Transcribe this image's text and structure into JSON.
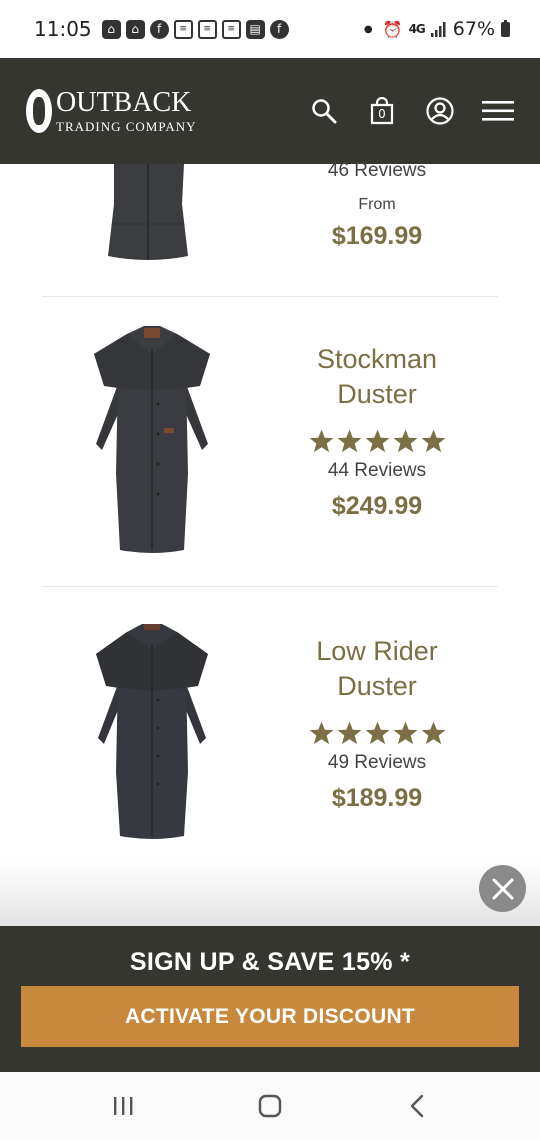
{
  "status_bar": {
    "time": "11:05",
    "network": "4G",
    "battery": "67%",
    "notification_icons": [
      "nextdoor-icon",
      "nextdoor-icon",
      "facebook-icon",
      "news-icon",
      "news-icon",
      "news-icon",
      "newspaper-app-icon",
      "facebook-icon"
    ],
    "system_icons": [
      "alarm-icon",
      "lte-icon",
      "signal-icon",
      "battery-icon"
    ]
  },
  "header": {
    "logo_main": "OUTBACK",
    "logo_sub": "TRADING COMPANY",
    "cart_count": "0",
    "icons": [
      "search-icon",
      "cart-icon",
      "account-icon",
      "menu-icon"
    ]
  },
  "products": [
    {
      "reviews": "46 Reviews",
      "price_prefix": "From",
      "price": "$169.99"
    },
    {
      "title_line1": "Stockman",
      "title_line2": "Duster",
      "stars": 5,
      "reviews": "44 Reviews",
      "price": "$249.99"
    },
    {
      "title_line1": "Low Rider",
      "title_line2": "Duster",
      "stars": 5,
      "reviews": "49 Reviews",
      "price": "$189.99"
    }
  ],
  "signup": {
    "title": "SIGN UP & SAVE 15% *",
    "button": "ACTIVATE YOUR DISCOUNT"
  },
  "nav_bar": {
    "icons": [
      "recent-apps-icon",
      "home-icon",
      "back-icon"
    ]
  },
  "colors": {
    "header_bg": "#353630",
    "accent_olive": "#7a6f45",
    "button_orange": "#c8883d"
  }
}
